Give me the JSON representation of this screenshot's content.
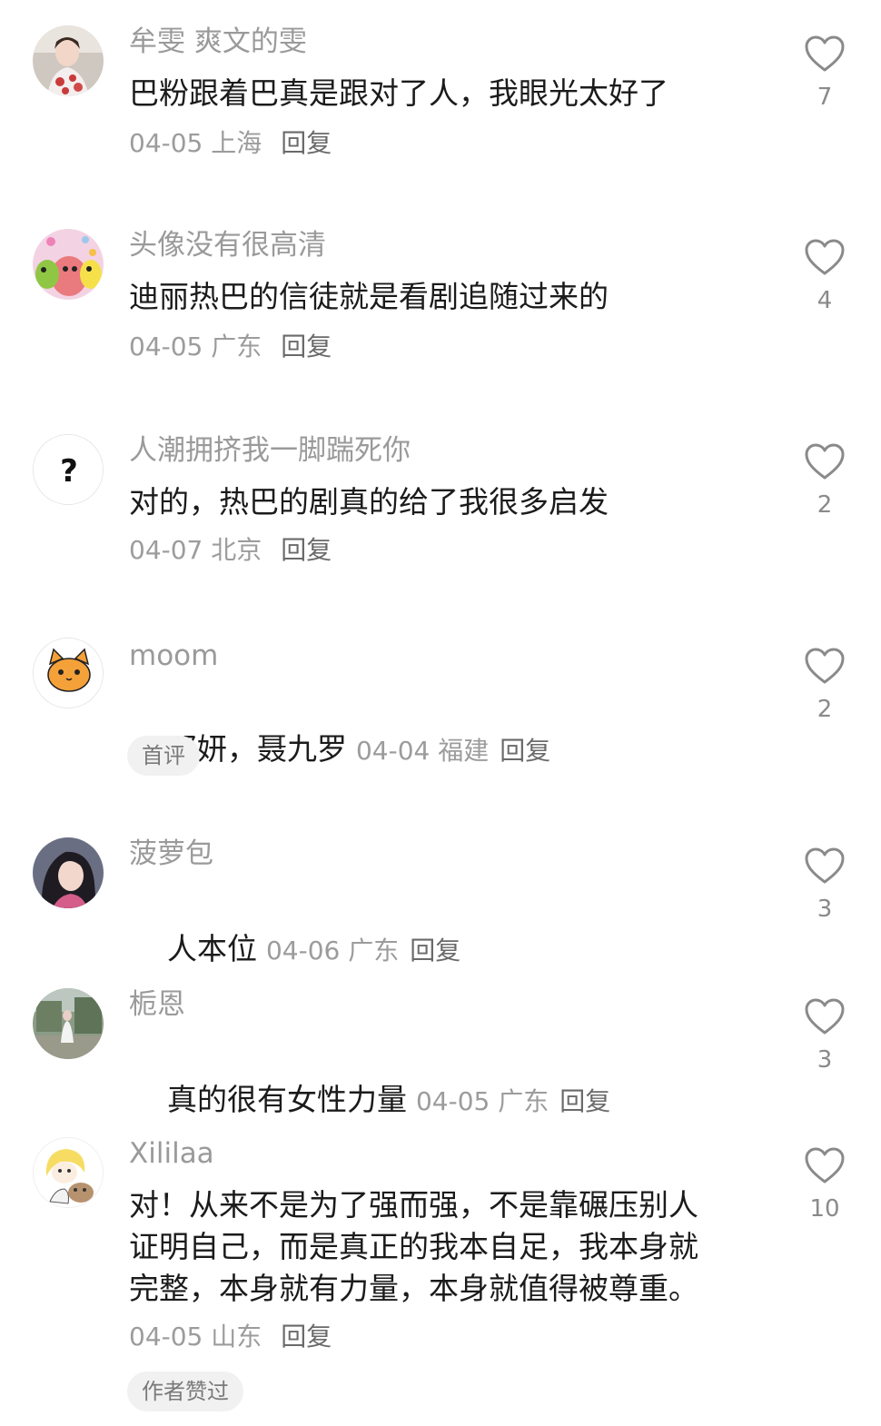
{
  "comments": [
    {
      "username": "牟雯 爽文的雯",
      "text": "巴粉跟着巴真是跟对了人，我眼光太好了",
      "date": "04-05",
      "location": "上海",
      "reply": "回复",
      "likes": "7",
      "avatar": "portrait-avatar"
    },
    {
      "username": "头像没有很高清",
      "text": "迪丽热巴的信徒就是看剧追随过来的",
      "date": "04-05",
      "location": "广东",
      "reply": "回复",
      "likes": "4",
      "avatar": "cartoon-avatar"
    },
    {
      "username": "人潮拥挤我一脚踹死你",
      "text": "对的，热巴的剧真的给了我很多启发",
      "date": "04-07",
      "location": "北京",
      "reply": "回复",
      "likes": "2",
      "avatar": "question-mark-avatar"
    },
    {
      "username": "moom",
      "text": "邓妍，聂九罗",
      "date": "04-04",
      "location": "福建",
      "reply": "回复",
      "likes": "2",
      "badge": "首评",
      "avatar": "cat-avatar"
    },
    {
      "username": "菠萝包",
      "text": "人本位",
      "date": "04-06",
      "location": "广东",
      "reply": "回复",
      "likes": "3",
      "avatar": "portrait-avatar"
    },
    {
      "username": "栀恩",
      "text": "真的很有女性力量",
      "date": "04-05",
      "location": "广东",
      "reply": "回复",
      "likes": "3",
      "avatar": "photo-avatar"
    },
    {
      "username": "Xililaa",
      "text": "对！从来不是为了强而强，不是靠碾压别人\n证明自己，而是真正的我本自足，我本身就\n完整，本身就有力量，本身就值得被尊重。",
      "date": "04-05",
      "location": "山东",
      "reply": "回复",
      "likes": "10",
      "badge": "作者赞过",
      "avatar": "cartoon-avatar"
    }
  ],
  "colors": {
    "username": "#9a9a9a",
    "text": "#1b1b1b",
    "meta": "#9c9c9c",
    "badge_bg": "#f1f1f1",
    "heart": "#8a8a8a"
  }
}
